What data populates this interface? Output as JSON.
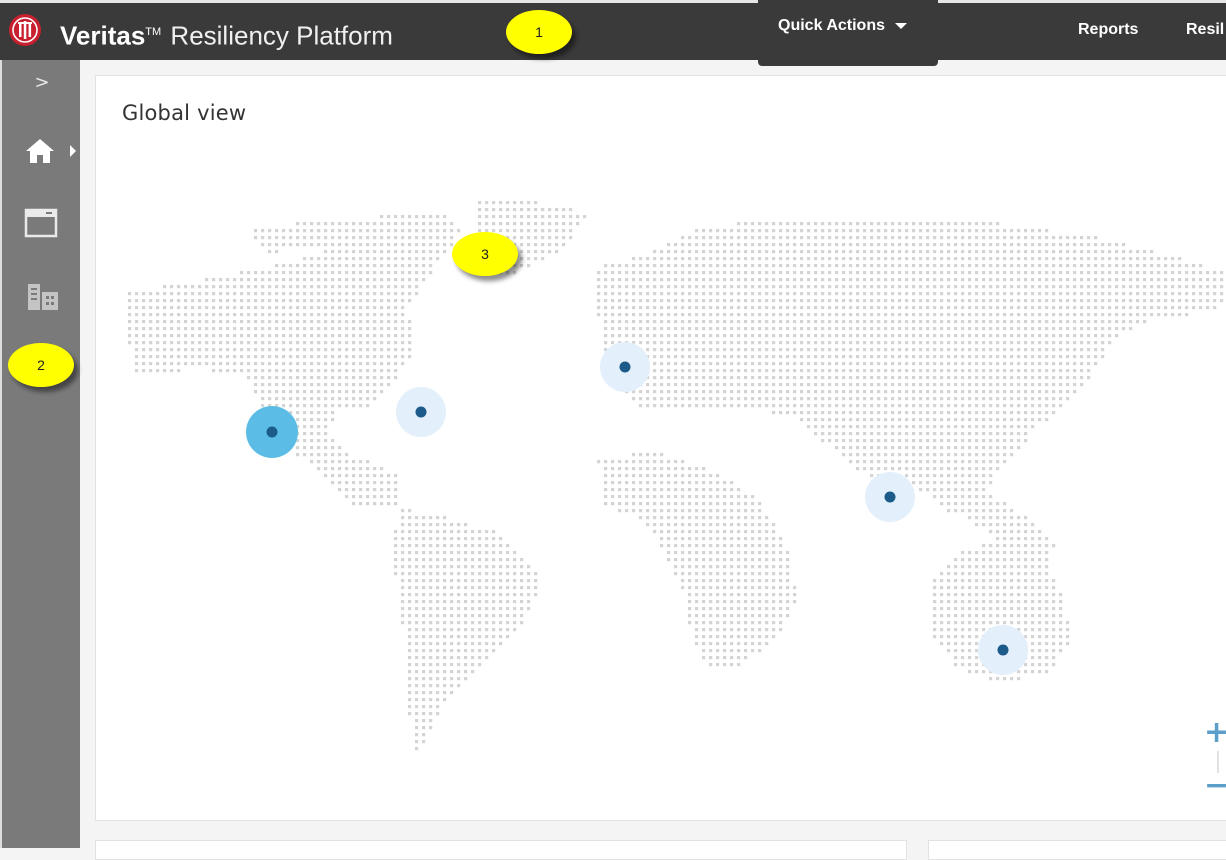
{
  "header": {
    "brand_name": "Veritas",
    "brand_tm": "TM",
    "product_name": "Resiliency Platform",
    "quick_actions_label": "Quick Actions",
    "nav_reports": "Reports",
    "nav_resiliency": "Resil"
  },
  "callouts": [
    "1",
    "2",
    "3"
  ],
  "sidebar": {
    "expand_glyph": ">",
    "items": [
      {
        "name": "home",
        "icon": "home-icon",
        "active": true
      },
      {
        "name": "assets",
        "icon": "window-icon",
        "active": false
      },
      {
        "name": "infrastructure",
        "icon": "buildings-icon",
        "active": false
      }
    ]
  },
  "main": {
    "title": "Global view",
    "zoom_in_label": "+",
    "zoom_out_label": "−",
    "map_markers": [
      {
        "location": "west-us",
        "highlight": true
      },
      {
        "location": "east-us",
        "highlight": false
      },
      {
        "location": "europe",
        "highlight": false
      },
      {
        "location": "india",
        "highlight": false
      },
      {
        "location": "australia",
        "highlight": false
      }
    ]
  },
  "colors": {
    "topbar": "#3a3a3a",
    "sidebar": "#7a7a7a",
    "marker_core": "#1c5a8a",
    "marker_halo_strong": "#5bbde6",
    "marker_halo_light": "#e3effa",
    "map_dot": "#d4d4d4",
    "callout": "#ffff00"
  }
}
